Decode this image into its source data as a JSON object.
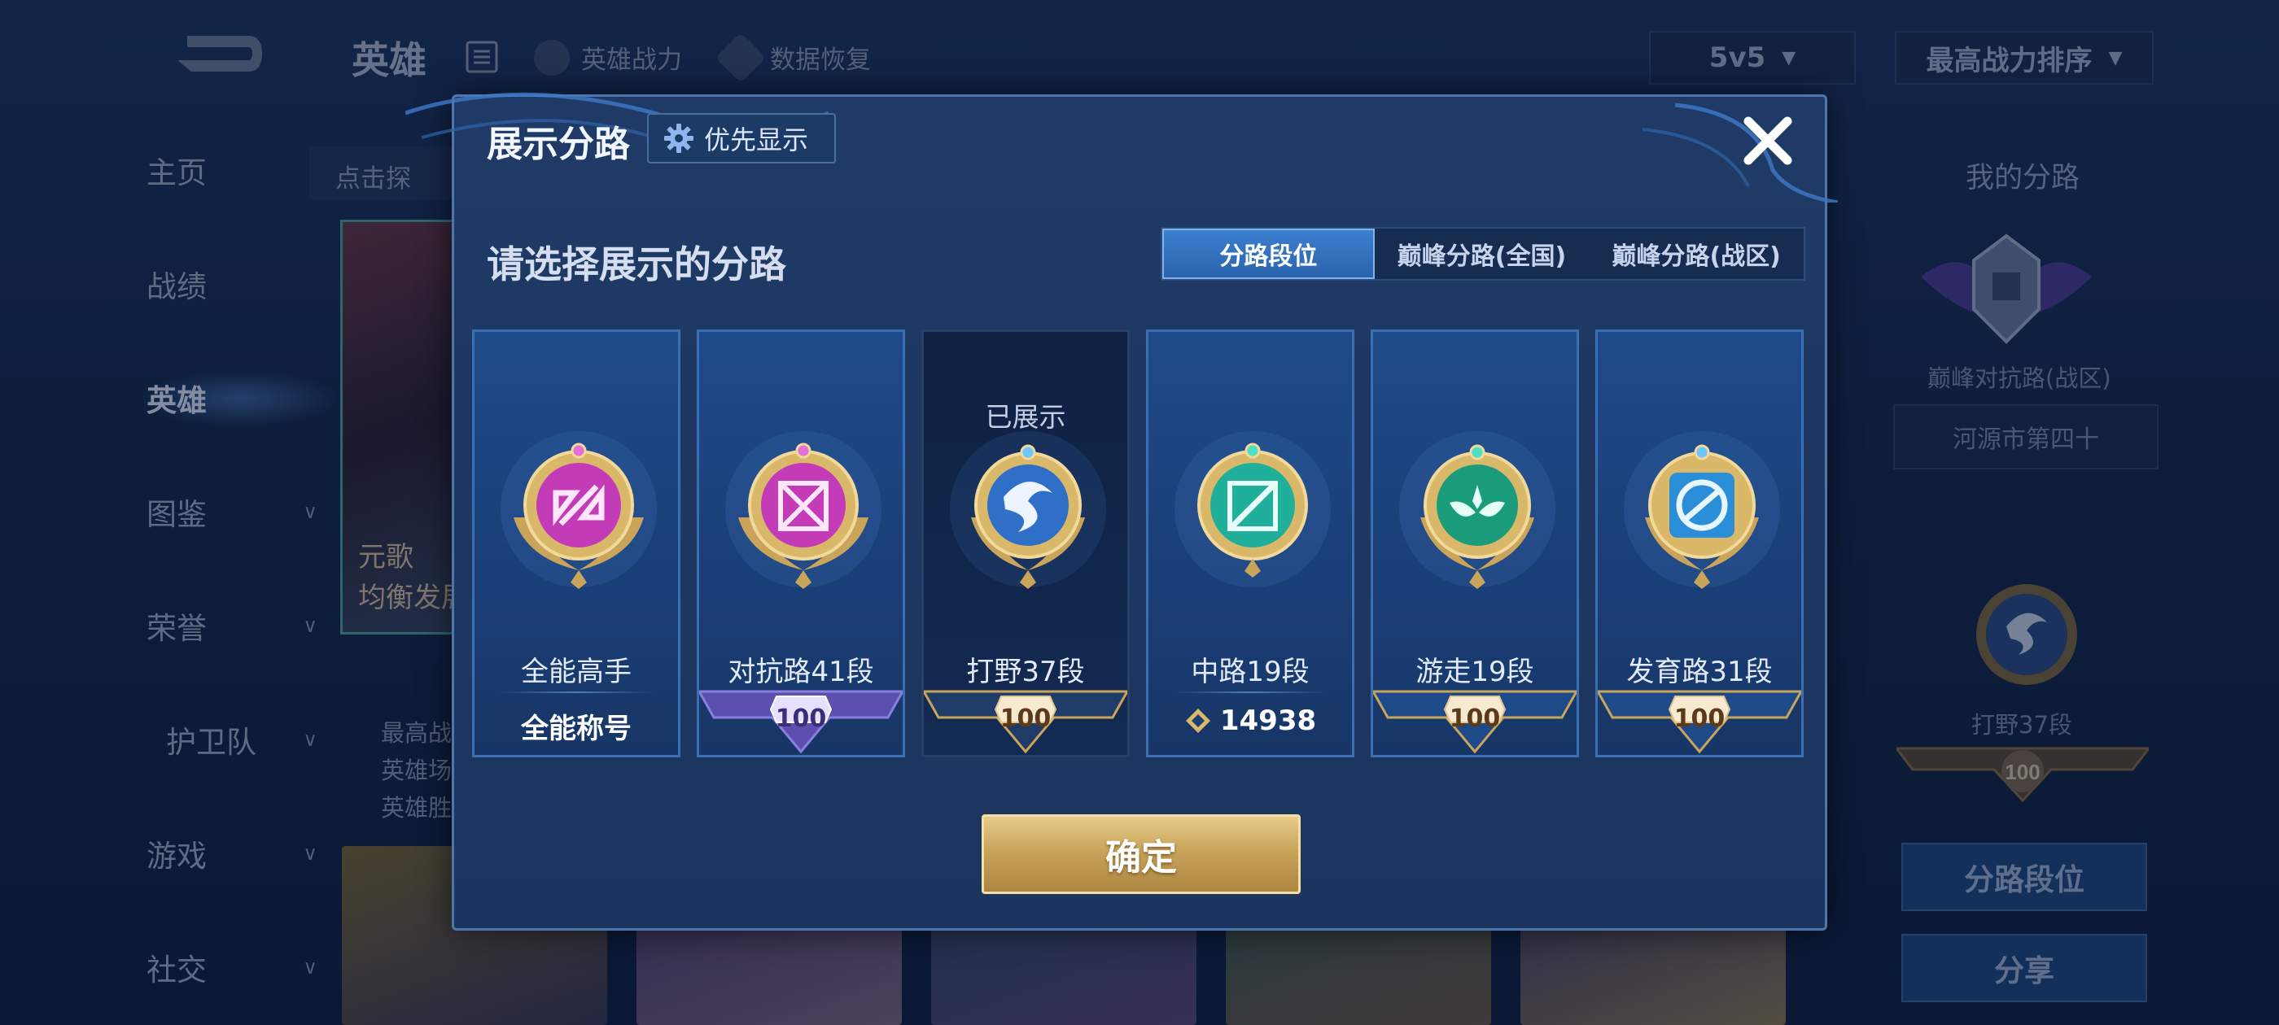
{
  "background": {
    "header": {
      "title": "英雄",
      "hero_power": "英雄战力",
      "data_restore": "数据恢复",
      "mode_select": "5v5",
      "sort_select": "最高战力排序"
    },
    "sidenav": [
      {
        "label": "主页",
        "has_chevron": false
      },
      {
        "label": "战绩",
        "has_chevron": false
      },
      {
        "label": "英雄",
        "has_chevron": false,
        "active": true
      },
      {
        "label": "图鉴",
        "has_chevron": true
      },
      {
        "label": "荣誉",
        "has_chevron": true
      },
      {
        "label": "护卫队",
        "has_chevron": true
      },
      {
        "label": "游戏",
        "has_chevron": true
      },
      {
        "label": "社交",
        "has_chevron": true
      }
    ],
    "hint": "点击探",
    "hero_card": {
      "line1": "元歌",
      "line2": "均衡发展"
    },
    "hero_stats": [
      "最高战",
      "英雄场",
      "英雄胜"
    ],
    "right_panel": {
      "title": "我的分路",
      "badge_label": "巅峰对抗路(战区)",
      "region": "河源市第四十",
      "medal_label": "打野37段",
      "banner_value": "100",
      "btn_lane_rank": "分路段位",
      "btn_share": "分享"
    }
  },
  "modal": {
    "title": "展示分路",
    "priority_button": "优先显示",
    "prompt": "请选择展示的分路",
    "tabs": [
      {
        "label": "分路段位",
        "active": true
      },
      {
        "label": "巅峰分路(全国)",
        "active": false
      },
      {
        "label": "巅峰分路(战区)",
        "active": false
      }
    ],
    "cards": [
      {
        "name": "全能高手",
        "footer_text": "全能称号",
        "banner": "none",
        "medal_color": "#c43bb8",
        "selected": false
      },
      {
        "name": "对抗路41段",
        "banner": "purple",
        "banner_value": "100",
        "medal_color": "#c43bb8",
        "selected": false
      },
      {
        "name": "打野37段",
        "banner": "gold",
        "banner_value": "100",
        "medal_color": "#2f6fc8",
        "selected": true,
        "status": "已展示"
      },
      {
        "name": "中路19段",
        "banner": "points",
        "points": "14938",
        "medal_color": "#1faf9a",
        "selected": false
      },
      {
        "name": "游走19段",
        "banner": "gold",
        "banner_value": "100",
        "medal_color": "#1a9c7a",
        "selected": false
      },
      {
        "name": "发育路31段",
        "banner": "gold",
        "banner_value": "100",
        "medal_color": "#2a8fd8",
        "selected": false
      }
    ],
    "confirm_button": "确定"
  }
}
